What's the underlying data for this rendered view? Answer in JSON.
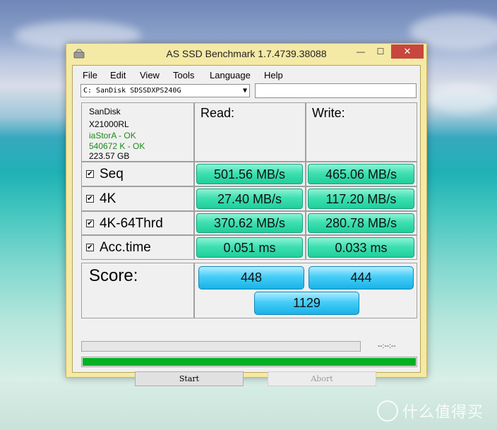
{
  "window": {
    "title": "AS SSD Benchmark 1.7.4739.38088",
    "minimize_glyph": "—",
    "maximize_glyph": "☐",
    "close_glyph": "✕"
  },
  "menu": [
    "File",
    "Edit",
    "View",
    "Tools",
    "Language",
    "Help"
  ],
  "drive": {
    "selected": "C: SanDisk SDSSDXPS240G"
  },
  "info": {
    "vendor": "SanDisk",
    "firmware": "X21000RL",
    "driver_status": "iaStorA - OK",
    "alignment_status": "540672 K - OK",
    "capacity": "223.57 GB",
    "ok_color": "#1a8a1a"
  },
  "headers": {
    "read": "Read:",
    "write": "Write:"
  },
  "tests": [
    {
      "label": "Seq",
      "checked": true,
      "read": "501.56 MB/s",
      "write": "465.06 MB/s"
    },
    {
      "label": "4K",
      "checked": true,
      "read": "27.40 MB/s",
      "write": "117.20 MB/s"
    },
    {
      "label": "4K-64Thrd",
      "checked": true,
      "read": "370.62 MB/s",
      "write": "280.78 MB/s"
    },
    {
      "label": "Acc.time",
      "checked": true,
      "read": "0.051 ms",
      "write": "0.033 ms"
    }
  ],
  "score": {
    "label": "Score:",
    "read": "448",
    "write": "444",
    "total": "1129"
  },
  "progress": {
    "timer": "--:--:--",
    "top_fill": 0,
    "bottom_fill": 1.0,
    "fill_color": "#06b025"
  },
  "buttons": {
    "start": "Start",
    "abort": "Abort"
  },
  "watermark": "什么值得买",
  "colors": {
    "window_frame": "#f5e9a6",
    "close_button": "#c7463d",
    "result_box": "#3fe0b1",
    "score_box": "#45cdf7"
  }
}
